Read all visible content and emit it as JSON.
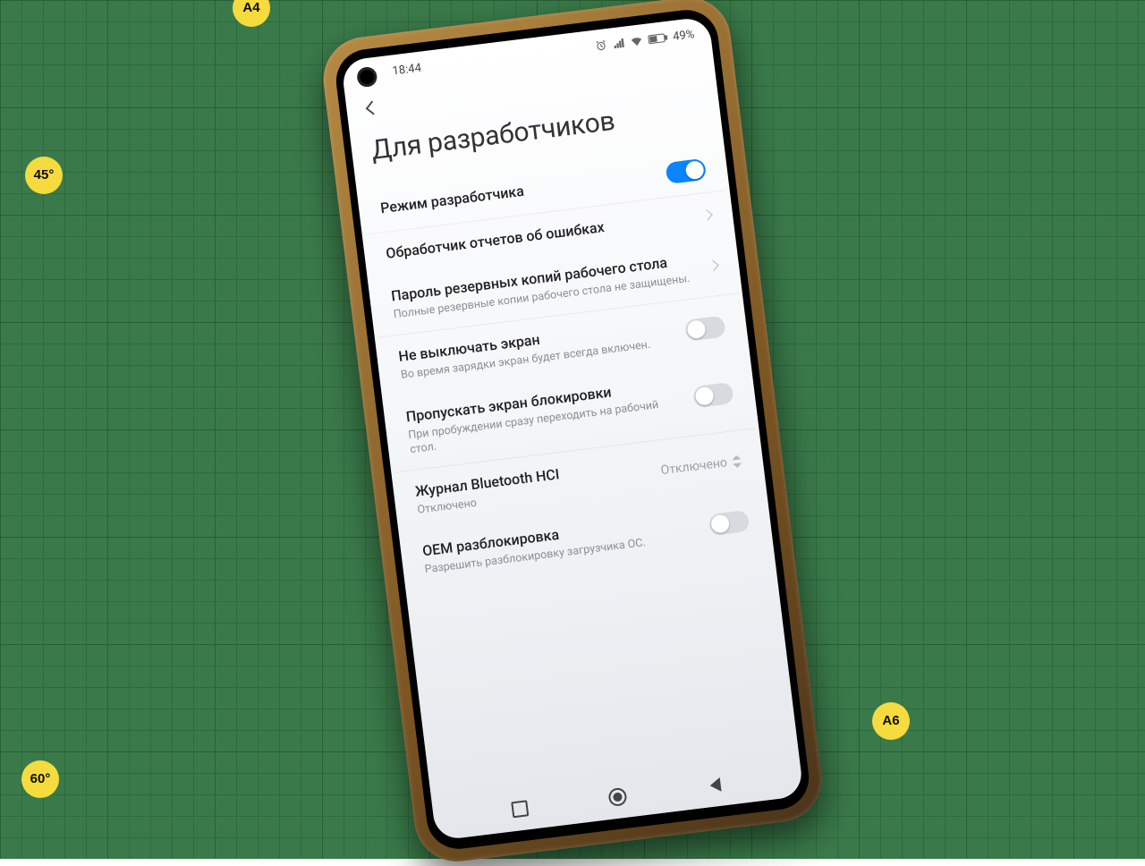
{
  "mat_labels": {
    "a4": "A4",
    "l45": "45°",
    "l60": "60°",
    "a6": "A6"
  },
  "status": {
    "time": "18:44",
    "battery": "49%"
  },
  "header": {
    "title": "Для разработчиков"
  },
  "rows": {
    "dev_mode": {
      "title": "Режим разработчика"
    },
    "bug_reports": {
      "title": "Обработчик отчетов об ошибках"
    },
    "backup_pw": {
      "title": "Пароль резервных копий рабочего стола",
      "sub": "Полные резервные копии рабочего стола не защищены."
    },
    "stay_awake": {
      "title": "Не выключать экран",
      "sub": "Во время зарядки экран будет всегда включен."
    },
    "skip_lock": {
      "title": "Пропускать экран блокировки",
      "sub": "При пробуждении сразу переходить на рабочий стол."
    },
    "bt_hci": {
      "title": "Журнал Bluetooth HCI",
      "sub": "Отключено",
      "value": "Отключено"
    },
    "oem": {
      "title": "OEM разблокировка",
      "sub": "Разрешить разблокировку загрузчика ОС."
    }
  }
}
